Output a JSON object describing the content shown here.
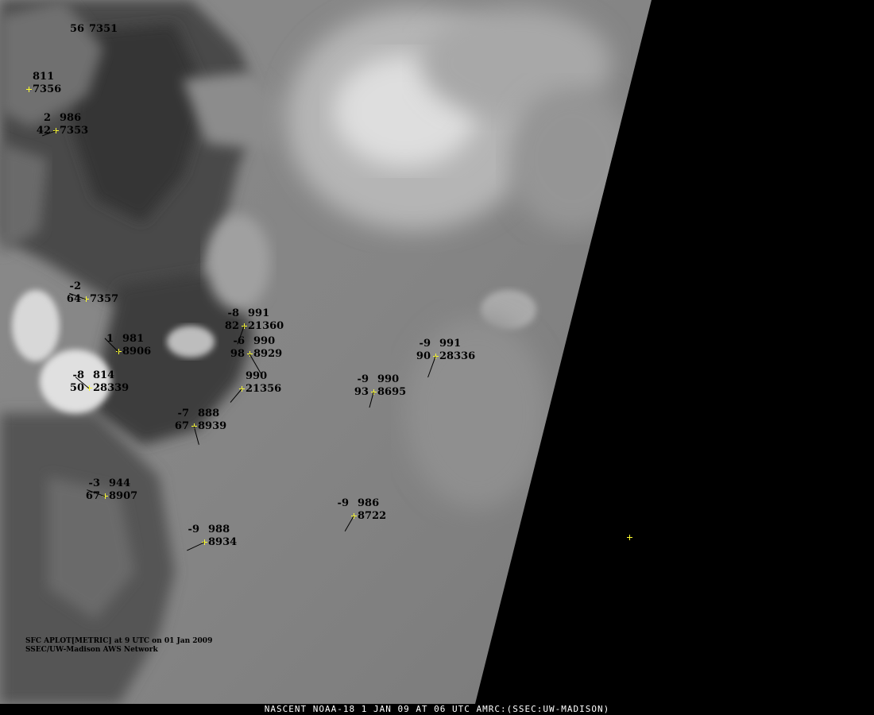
{
  "colors": {
    "marker": "#ffff30",
    "text": "#000000",
    "background": "#000000",
    "footer_text": "#ffffff"
  },
  "stations": [
    {
      "id": "st-top",
      "top_left": "",
      "top_right": "56",
      "bottom_left": "",
      "bottom_right": "7351"
    },
    {
      "id": "st-a",
      "top_left": "",
      "top_right": "811",
      "bottom_left": "",
      "bottom_right": "7356"
    },
    {
      "id": "st-b",
      "top_left": "2",
      "top_right": "986",
      "bottom_left": "42",
      "bottom_right": "7353"
    },
    {
      "id": "st-c",
      "top_left": "-2",
      "top_right": "",
      "bottom_left": "64",
      "bottom_right": "7357"
    },
    {
      "id": "st-d",
      "top_left": "-8",
      "top_right": "991",
      "bottom_left": "82",
      "bottom_right": "21360"
    },
    {
      "id": "st-e",
      "top_left": "-6",
      "top_right": "990",
      "bottom_left": "98",
      "bottom_right": "8929"
    },
    {
      "id": "st-f",
      "top_left": "1",
      "top_right": "981",
      "bottom_left": "",
      "bottom_right": "8906"
    },
    {
      "id": "st-g",
      "top_left": "-8",
      "top_right": "814",
      "bottom_left": "50",
      "bottom_right": "28339"
    },
    {
      "id": "st-h",
      "top_left": "",
      "top_right": "990",
      "bottom_left": "",
      "bottom_right": "21356"
    },
    {
      "id": "st-i",
      "top_left": "-7",
      "top_right": "888",
      "bottom_left": "67",
      "bottom_right": "8939"
    },
    {
      "id": "st-j",
      "top_left": "-3",
      "top_right": "944",
      "bottom_left": "67",
      "bottom_right": "8907"
    },
    {
      "id": "st-k",
      "top_left": "-9",
      "top_right": "988",
      "bottom_left": "",
      "bottom_right": "8934"
    },
    {
      "id": "st-l",
      "top_left": "-9",
      "top_right": "990",
      "bottom_left": "93",
      "bottom_right": "8695"
    },
    {
      "id": "st-m",
      "top_left": "-9",
      "top_right": "991",
      "bottom_left": "90",
      "bottom_right": "28336"
    },
    {
      "id": "st-n",
      "top_left": "-9",
      "top_right": "986",
      "bottom_left": "",
      "bottom_right": "8722"
    }
  ],
  "legend": {
    "line1": "SFC APLOT[METRIC] at 9 UTC on 01 Jan 2009",
    "line2": "SSEC/UW-Madison AWS Network"
  },
  "footer": "NASCENT NOAA-18 1 JAN 09 AT 06 UTC AMRC:(SSEC:UW-MADISON)"
}
